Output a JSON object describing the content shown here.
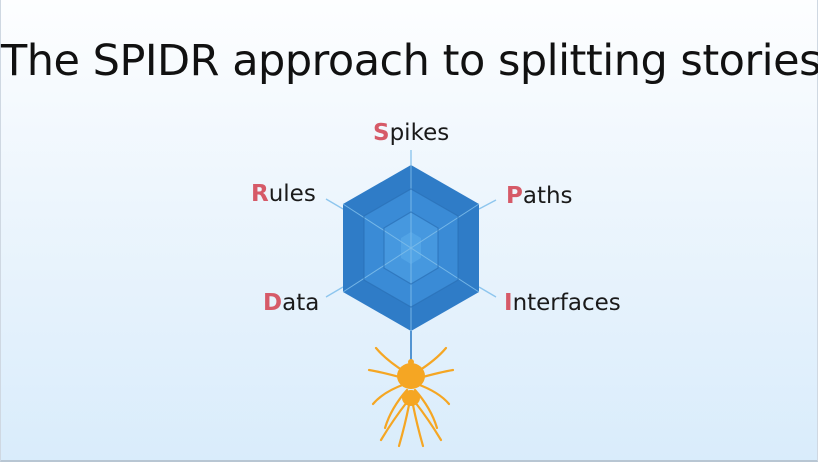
{
  "title": "The SPIDR approach to splitting stories",
  "labels": {
    "spikes": {
      "initial": "S",
      "rest": "pikes"
    },
    "paths": {
      "initial": "P",
      "rest": "aths"
    },
    "interfaces": {
      "initial": "I",
      "rest": "nterfaces"
    },
    "data": {
      "initial": "D",
      "rest": "ata"
    },
    "rules": {
      "initial": "R",
      "rest": "ules"
    }
  },
  "colors": {
    "accent_letter": "#d65a68",
    "web_outer": "#2f7cc7",
    "web_inner": "#4da6e8",
    "spider": "#f5a623"
  },
  "icons": [
    "hexagon-web-icon",
    "spider-icon"
  ]
}
